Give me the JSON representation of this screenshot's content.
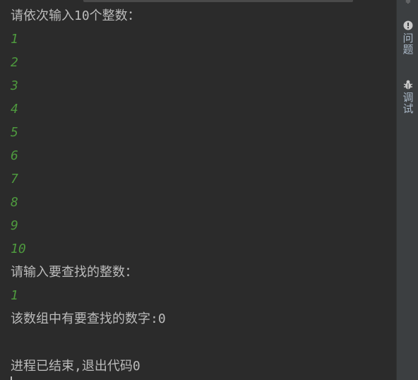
{
  "console": {
    "prompt_input_numbers": "请依次输入10个整数：",
    "inputs": [
      "1",
      "2",
      "3",
      "4",
      "5",
      "6",
      "7",
      "8",
      "9",
      "10"
    ],
    "prompt_search": "请输入要查找的整数：",
    "search_input": "1",
    "result": "该数组中有要查找的数字:0",
    "exit_message": "进程已结束,退出代码0"
  },
  "side_panel": {
    "top_mark": "≑",
    "problems_label": "问题",
    "problems_icon": "exclamation-circle-icon",
    "debug_label": "调试",
    "debug_icon": "bug-icon"
  },
  "colors": {
    "background": "#2b2b2b",
    "system_text": "#bbbbbb",
    "user_input": "#4e9a3e",
    "side_panel": "#3c3f41"
  }
}
